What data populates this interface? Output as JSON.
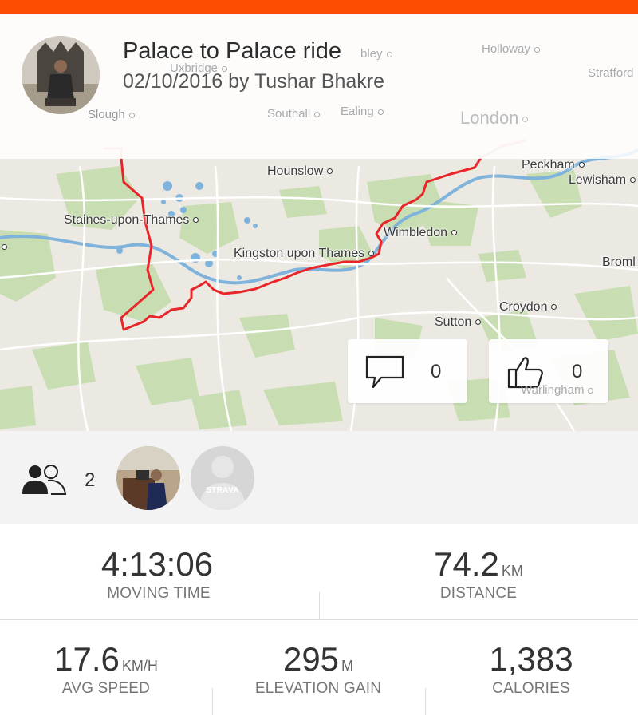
{
  "activity": {
    "title": "Palace to Palace ride",
    "subtitle": "02/10/2016 by Tushar Bhakre"
  },
  "map": {
    "labels": [
      {
        "id": "slough",
        "text": "Slough"
      },
      {
        "id": "uxbridge",
        "text": "Uxbridge"
      },
      {
        "id": "wembley",
        "text": "bley"
      },
      {
        "id": "holloway",
        "text": "Holloway"
      },
      {
        "id": "stratford",
        "text": "Stratford"
      },
      {
        "id": "southall",
        "text": "Southall"
      },
      {
        "id": "ealing",
        "text": "Ealing"
      },
      {
        "id": "london",
        "text": "London"
      },
      {
        "id": "hounslow",
        "text": "Hounslow"
      },
      {
        "id": "peckham",
        "text": "Peckham"
      },
      {
        "id": "lewisham",
        "text": "Lewisham"
      },
      {
        "id": "staines",
        "text": "Staines-upon-Thames"
      },
      {
        "id": "wimbledon",
        "text": "Wimbledon"
      },
      {
        "id": "kingston",
        "text": "Kingston upon Thames"
      },
      {
        "id": "bromley",
        "text": "Broml"
      },
      {
        "id": "croydon",
        "text": "Croydon"
      },
      {
        "id": "sutton",
        "text": "Sutton"
      },
      {
        "id": "warlingham",
        "text": "Warlingham"
      }
    ],
    "route_color": "#e8262a"
  },
  "social": {
    "comments": "0",
    "kudos": "0",
    "athlete_count": "2",
    "strava_badge": "STRAVA"
  },
  "stats": {
    "moving_time": {
      "value": "4:13:06",
      "unit": "",
      "label": "MOVING TIME"
    },
    "distance": {
      "value": "74.2",
      "unit": "KM",
      "label": "DISTANCE"
    },
    "avg_speed": {
      "value": "17.6",
      "unit": "KM/H",
      "label": "AVG SPEED"
    },
    "elevation_gain": {
      "value": "295",
      "unit": "M",
      "label": "ELEVATION GAIN"
    },
    "calories": {
      "value": "1,383",
      "unit": "",
      "label": "CALORIES"
    }
  },
  "colors": {
    "accent": "#fc4c02",
    "route": "#e8262a"
  }
}
